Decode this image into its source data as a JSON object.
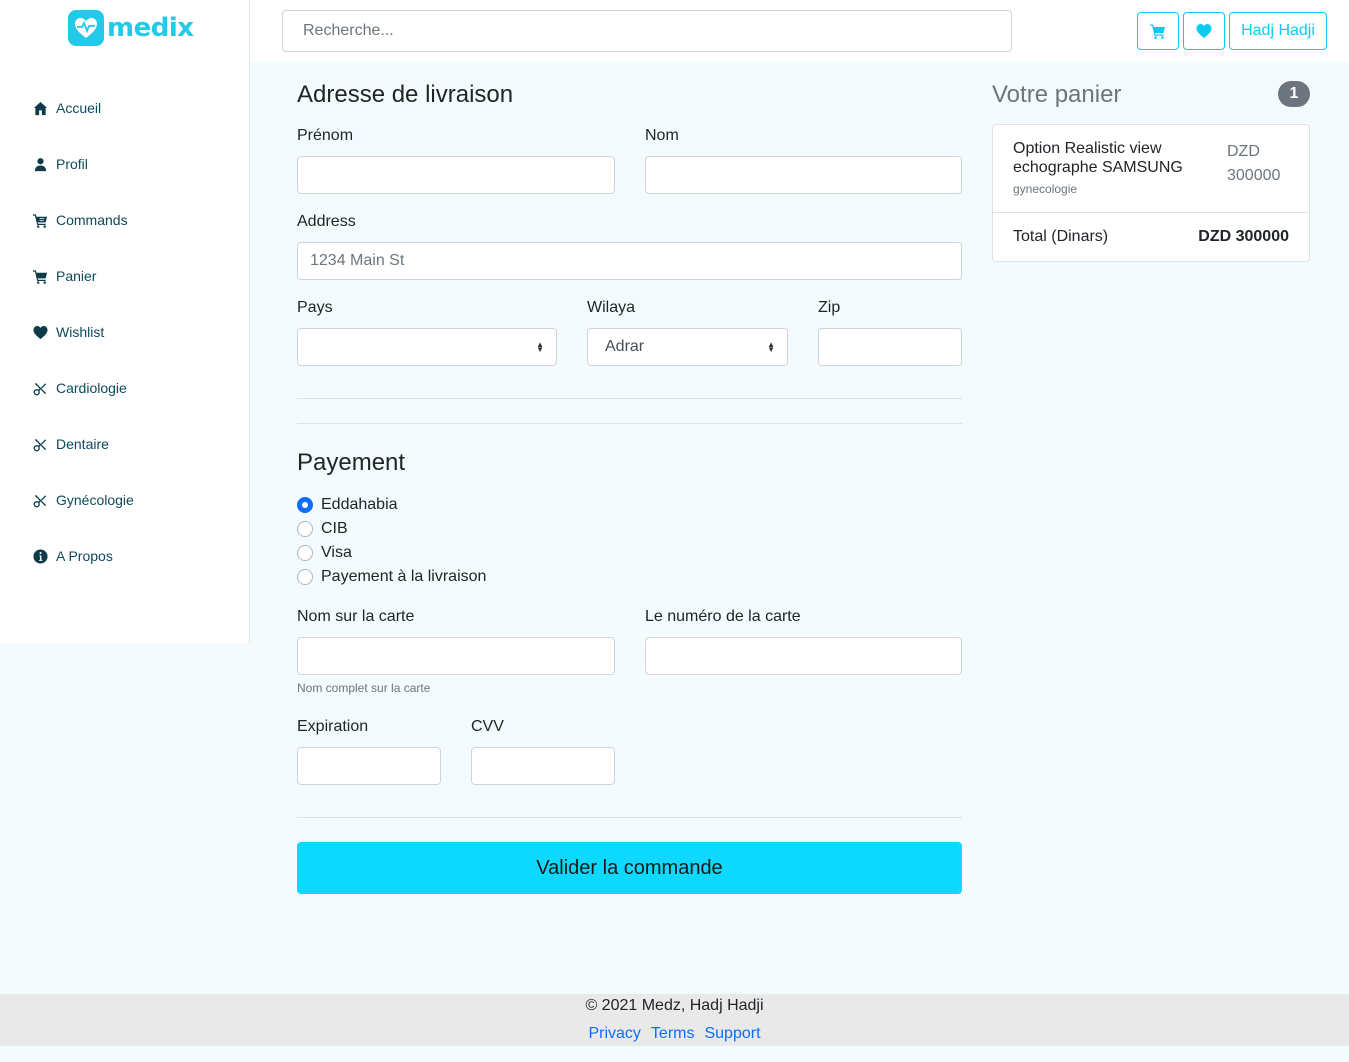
{
  "brand": {
    "name": "medix",
    "color": "#22c9e8"
  },
  "header": {
    "search_placeholder": "Recherche...",
    "cart_icon": "cart-icon",
    "wishlist_icon": "heart-icon",
    "user_label": "Hadj Hadji"
  },
  "sidebar": {
    "items": [
      {
        "label": "Accueil",
        "icon": "home-icon"
      },
      {
        "label": "Profil",
        "icon": "user-icon"
      },
      {
        "label": "Commands",
        "icon": "cart-icon"
      },
      {
        "label": "Panier",
        "icon": "cart-icon"
      },
      {
        "label": "Wishlist",
        "icon": "heart-icon"
      },
      {
        "label": "Cardiologie",
        "icon": "tools-icon"
      },
      {
        "label": "Dentaire",
        "icon": "tools-icon"
      },
      {
        "label": "Gynécologie",
        "icon": "tools-icon"
      },
      {
        "label": "A Propos",
        "icon": "info-icon"
      }
    ]
  },
  "shipping": {
    "title": "Adresse de livraison",
    "first_name_label": "Prénom",
    "first_name_value": "",
    "last_name_label": "Nom",
    "last_name_value": "",
    "address_label": "Address",
    "address_placeholder": "1234 Main St",
    "country_label": "Pays",
    "country_value": "",
    "wilaya_label": "Wilaya",
    "wilaya_value": "Adrar",
    "zip_label": "Zip",
    "zip_value": ""
  },
  "payment": {
    "title": "Payement",
    "methods": [
      {
        "label": "Eddahabia",
        "checked": true
      },
      {
        "label": "CIB",
        "checked": false
      },
      {
        "label": "Visa",
        "checked": false
      },
      {
        "label": "Payement à la livraison",
        "checked": false
      }
    ],
    "card_name_label": "Nom sur la carte",
    "card_name_help": "Nom complet sur la carte",
    "card_number_label": "Le numéro de la carte",
    "expiration_label": "Expiration",
    "cvv_label": "CVV",
    "submit_label": "Valider la commande"
  },
  "cart": {
    "title": "Votre panier",
    "count": "1",
    "items": [
      {
        "name": "Option Realistic view echographe SAMSUNG",
        "category": "gynecologie",
        "price": "DZD 300000"
      }
    ],
    "total_label": "Total (Dinars)",
    "total_value": "DZD 300000"
  },
  "footer": {
    "copyright": "© 2021 Medz, Hadj Hadji",
    "links": [
      "Privacy",
      "Terms",
      "Support"
    ]
  },
  "colors": {
    "accent": "#0dcaf0",
    "submit": "#0dd8fd",
    "radio_checked": "#0d6efd",
    "link": "#0d6efd"
  }
}
